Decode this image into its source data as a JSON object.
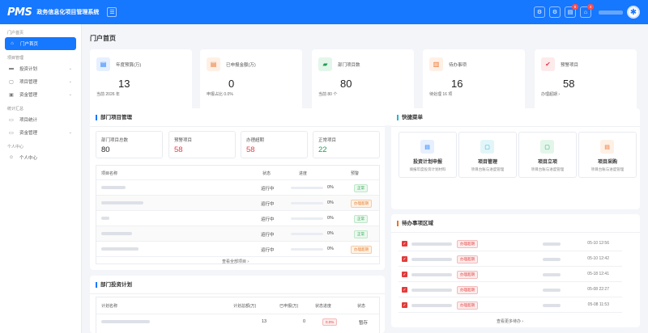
{
  "header": {
    "logo": "PMS",
    "title": "政务信息化项目管理系统",
    "menu_icon": "☰",
    "buttons": [
      {
        "icon": "⚙"
      },
      {
        "icon": "⚙"
      },
      {
        "icon": "▤",
        "badge": "8"
      },
      {
        "icon": "⌂",
        "badge": "4"
      }
    ],
    "avatar_icon": "✱"
  },
  "sidebar": {
    "groups": [
      {
        "label": "门户首页",
        "items": [
          {
            "label": "门户首页",
            "icon": "⌂",
            "active": true
          }
        ]
      },
      {
        "label": "项目管理",
        "items": [
          {
            "label": "投资计划",
            "icon": "▬"
          },
          {
            "label": "项目管理",
            "icon": "▢"
          },
          {
            "label": "资金管理",
            "icon": "▣"
          }
        ]
      },
      {
        "label": "统计汇总",
        "items": [
          {
            "label": "项目统计",
            "icon": "▭"
          },
          {
            "label": "资金管理",
            "icon": "▭"
          }
        ]
      },
      {
        "label": "个人中心",
        "items": [
          {
            "label": "个人中心",
            "icon": "☺"
          }
        ]
      }
    ]
  },
  "page_title": "门户首页",
  "stats": [
    {
      "label": "年度预算(万)",
      "value": "13",
      "sub": "当前 2026 年",
      "icon": "▤",
      "color": "#1677ff",
      "bg": "#e6f0ff"
    },
    {
      "label": "已申报金额(万)",
      "value": "0",
      "sub": "申报占比 0.0%",
      "icon": "▤",
      "color": "#e8742a",
      "bg": "#fff0e6"
    },
    {
      "label": "部门项目数",
      "value": "80",
      "sub": "当前 80 个",
      "icon": "▰",
      "color": "#1f9d55",
      "bg": "#e3f6ea"
    },
    {
      "label": "待办事项",
      "value": "16",
      "sub": "待处理 16 项",
      "icon": "▥",
      "color": "#e8742a",
      "bg": "#fff0e6"
    },
    {
      "label": "预警项目",
      "value": "58",
      "sub": "办理超期 ›",
      "icon": "✔",
      "color": "#e0404a",
      "bg": "#fdeaea"
    }
  ],
  "dept": {
    "title": "部门项目管理",
    "boxes": [
      {
        "label": "部门项目总数",
        "value": "80",
        "color": "#222"
      },
      {
        "label": "预警项目",
        "value": "58",
        "color": "#e0404a"
      },
      {
        "label": "办理超期",
        "value": "58",
        "color": "#e0404a"
      },
      {
        "label": "正常项目",
        "value": "22",
        "color": "#1f9d55"
      }
    ],
    "headers": {
      "name": "项目名称",
      "status": "状态",
      "progress": "进度",
      "warn": "预警"
    },
    "rows": [
      {
        "status": "运行中",
        "progress": "0%",
        "warn": "正常",
        "warn_type": "ok"
      },
      {
        "status": "运行中",
        "progress": "0%",
        "warn": "办理超期",
        "warn_type": "warn"
      },
      {
        "status": "运行中",
        "progress": "0%",
        "warn": "正常",
        "warn_type": "ok"
      },
      {
        "status": "运行中",
        "progress": "0%",
        "warn": "正常",
        "warn_type": "ok"
      },
      {
        "status": "运行中",
        "progress": "0%",
        "warn": "办理超期",
        "warn_type": "warn"
      }
    ],
    "more": "查看全部项目 ›"
  },
  "invest": {
    "title": "部门投资计划",
    "headers": {
      "name": "计划名称",
      "amount": "计划总额(万)",
      "declared": "已申报(万)",
      "status": "状态进度",
      "state": "状态"
    },
    "rows": [
      {
        "amount": "13",
        "declared": "0",
        "status": "0.0%",
        "state": "暂存"
      }
    ]
  },
  "quick": {
    "title": "快捷菜单",
    "items": [
      {
        "title": "投资计划申报",
        "sub": "填报年度投资计划材料",
        "icon": "▤",
        "color": "#1677ff",
        "bg": "#e6f0ff"
      },
      {
        "title": "项目管理",
        "sub": "项目台账与进度管理",
        "icon": "▢",
        "color": "#13a8c2",
        "bg": "#e2f6f9"
      },
      {
        "title": "项目立项",
        "sub": "项目台账与进度管理",
        "icon": "▢",
        "color": "#1f9d55",
        "bg": "#e3f6ea"
      },
      {
        "title": "项目采购",
        "sub": "项目台账与进度管理",
        "icon": "▤",
        "color": "#e8742a",
        "bg": "#fff0e6"
      }
    ]
  },
  "todo": {
    "title": "待办事项区域",
    "items": [
      {
        "tag": "办理超期",
        "date": "05-10 12:56"
      },
      {
        "tag": "办理超期",
        "date": "05-10 12:42"
      },
      {
        "tag": "办理超期",
        "date": "05-18 12:41"
      },
      {
        "tag": "办理超期",
        "date": "05-08 22:27"
      },
      {
        "tag": "办理超期",
        "date": "05-08 11:53"
      }
    ],
    "more": "查看更多待办 ›"
  }
}
